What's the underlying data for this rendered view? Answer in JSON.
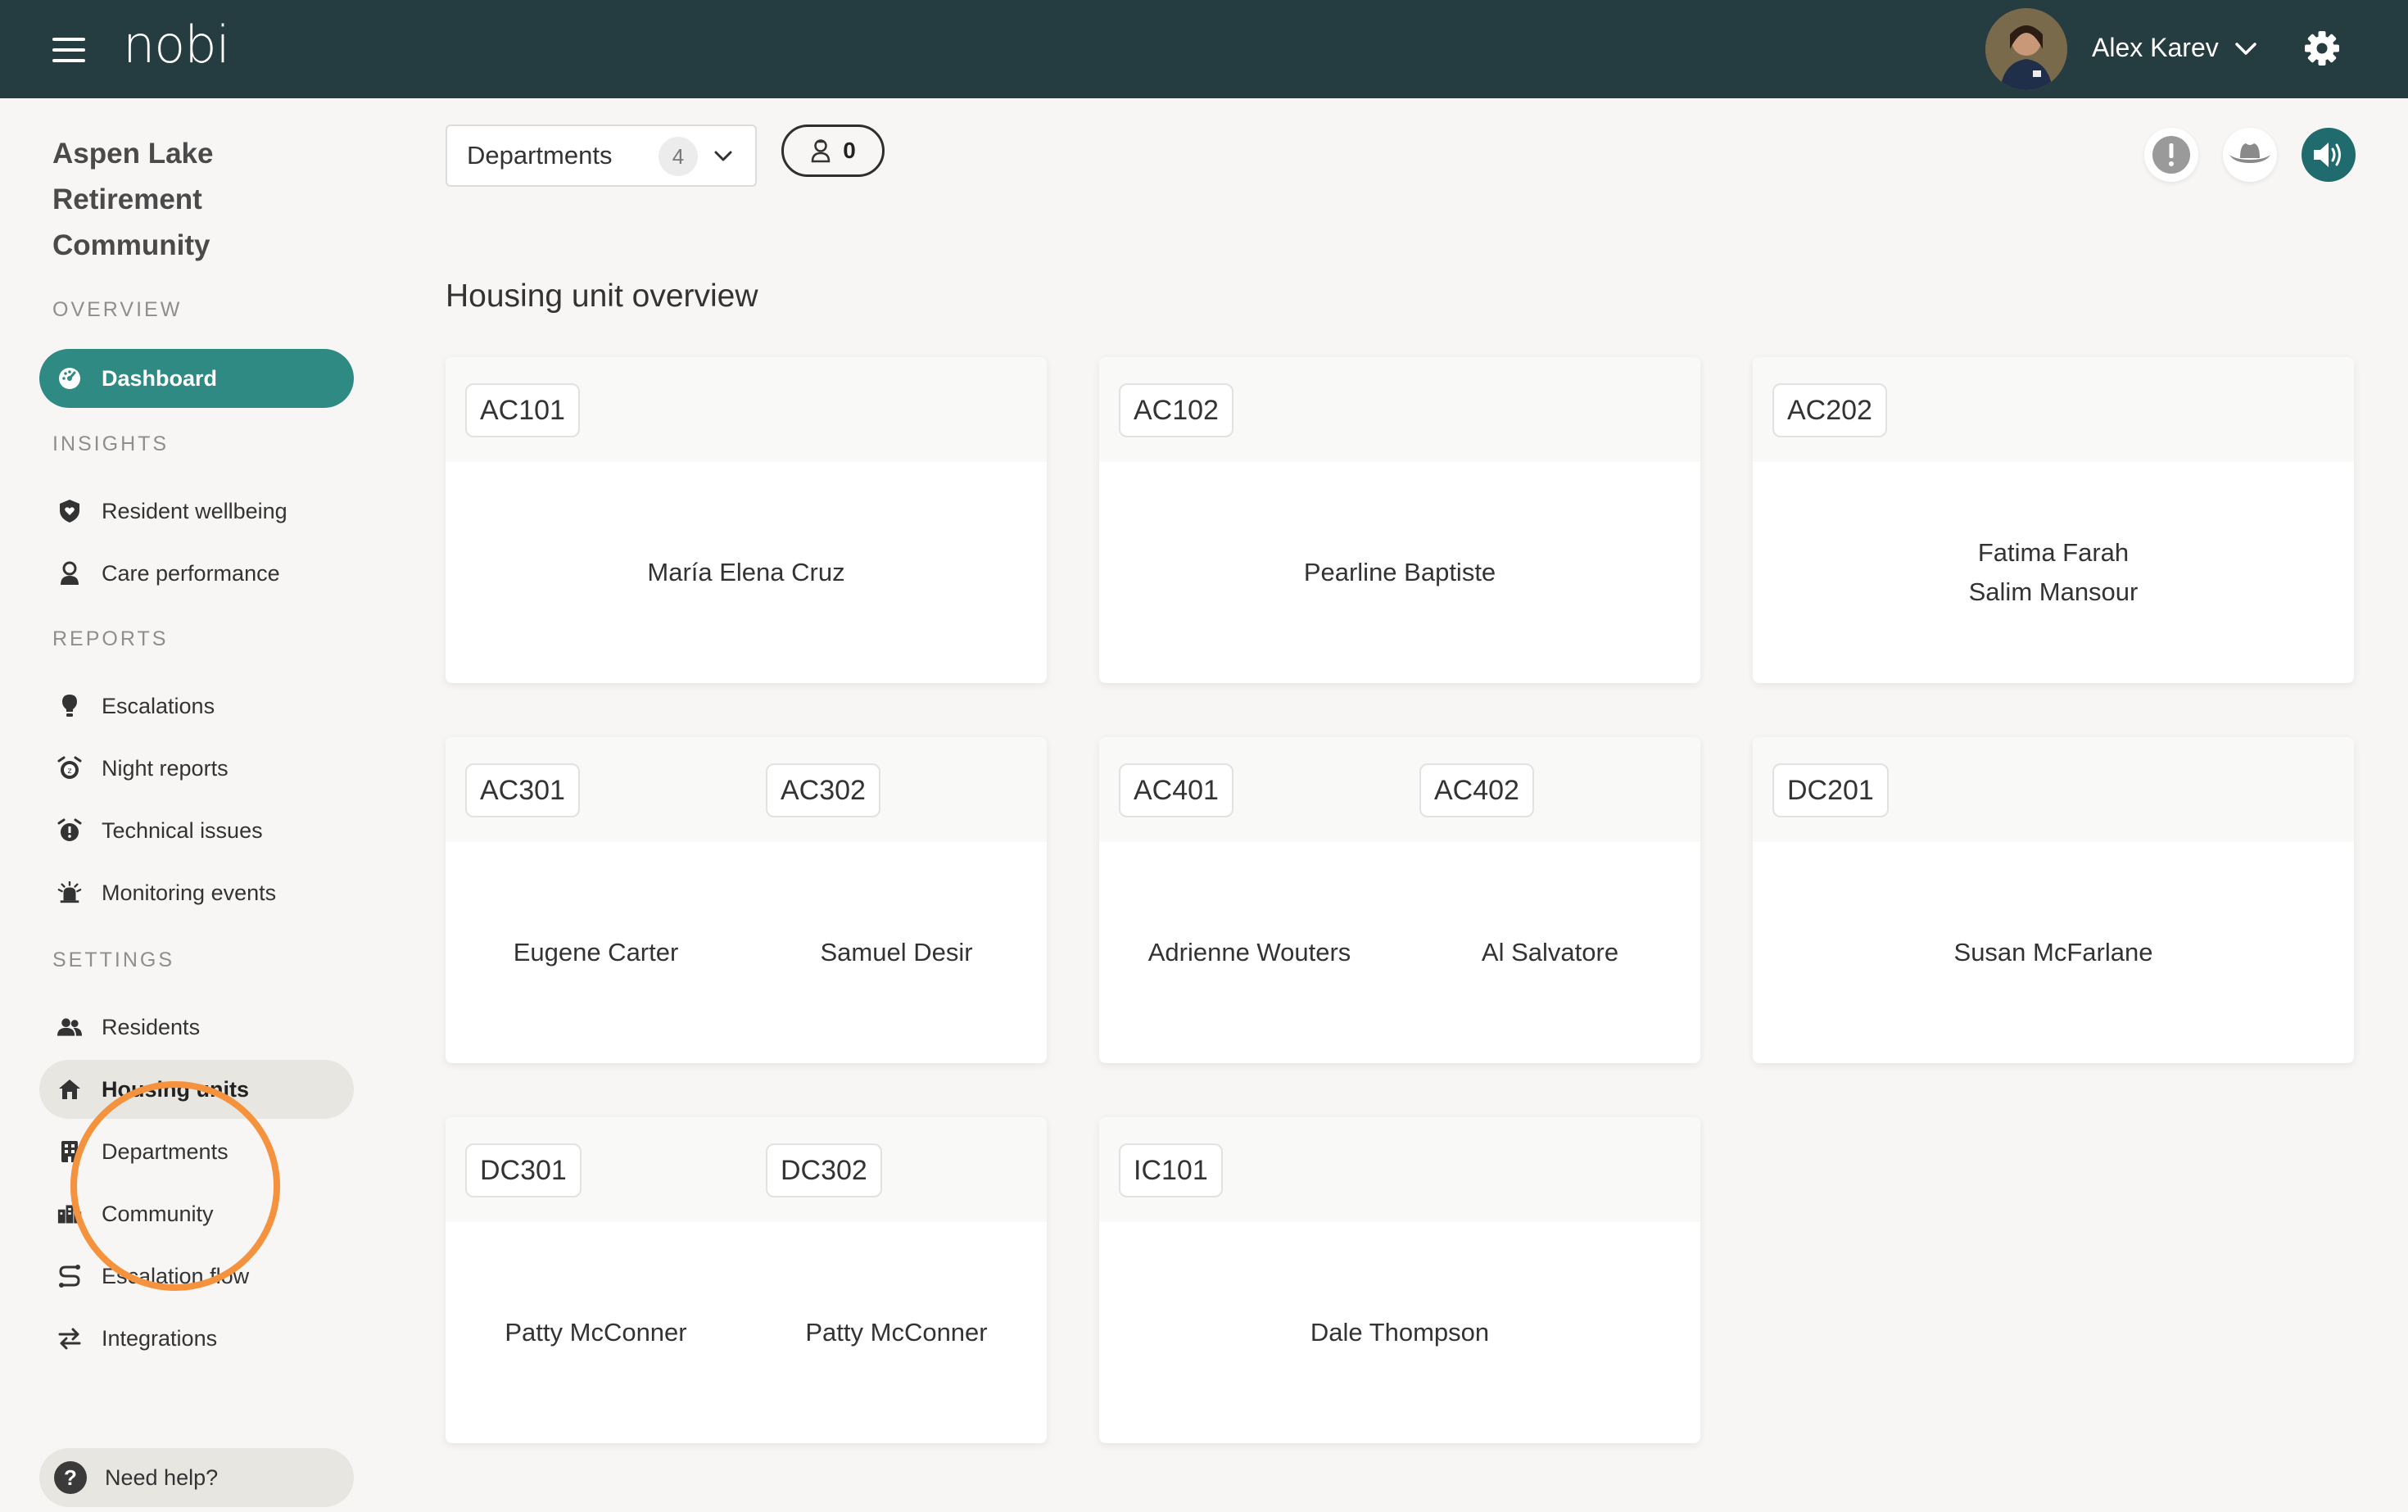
{
  "header": {
    "logo": "nobi",
    "user_name": "Alex Karev"
  },
  "sidebar": {
    "community_name": "Aspen Lake Retirement Community",
    "sections": {
      "overview": "OVERVIEW",
      "insights": "INSIGHTS",
      "reports": "REPORTS",
      "settings": "SETTINGS"
    },
    "items": {
      "dashboard": "Dashboard",
      "resident_wellbeing": "Resident wellbeing",
      "care_performance": "Care performance",
      "escalations": "Escalations",
      "night_reports": "Night reports",
      "technical_issues": "Technical issues",
      "monitoring_events": "Monitoring events",
      "residents": "Residents",
      "housing_units": "Housing units",
      "departments": "Departments",
      "community": "Community",
      "escalation_flow": "Escalation flow",
      "integrations": "Integrations"
    },
    "help": "Need help?",
    "active_item": "dashboard",
    "selected_item": "housing_units"
  },
  "toolbar": {
    "departments_label": "Departments",
    "departments_count": "4",
    "staff_count": "0"
  },
  "main": {
    "title": "Housing unit overview",
    "cards": [
      {
        "units": [
          {
            "code": "AC101",
            "residents": [
              "María Elena Cruz"
            ]
          }
        ]
      },
      {
        "units": [
          {
            "code": "AC102",
            "residents": [
              "Pearline Baptiste"
            ]
          }
        ]
      },
      {
        "units": [
          {
            "code": "AC202",
            "residents": [
              "Fatima Farah",
              "Salim Mansour"
            ]
          }
        ]
      },
      {
        "units": [
          {
            "code": "AC301",
            "residents": [
              "Eugene Carter"
            ]
          },
          {
            "code": "AC302",
            "residents": [
              "Samuel Desir"
            ]
          }
        ]
      },
      {
        "units": [
          {
            "code": "AC401",
            "residents": [
              "Adrienne Wouters"
            ]
          },
          {
            "code": "AC402",
            "residents": [
              "Al Salvatore"
            ]
          }
        ]
      },
      {
        "units": [
          {
            "code": "DC201",
            "residents": [
              "Susan McFarlane"
            ]
          }
        ]
      },
      {
        "units": [
          {
            "code": "DC301",
            "residents": [
              "Patty McConner"
            ]
          },
          {
            "code": "DC302",
            "residents": [
              "Patty McConner"
            ]
          }
        ]
      },
      {
        "units": [
          {
            "code": "IC101",
            "residents": [
              "Dale Thompson"
            ]
          }
        ]
      }
    ]
  },
  "colors": {
    "topbar": "#253c40",
    "accent": "#2e8a83",
    "highlight_ring": "#f5923e",
    "sound_button": "#1f6b6e"
  },
  "icons": {
    "menu": "hamburger-icon",
    "settings": "gear-icon",
    "user_menu": "chevron-down-icon",
    "alert": "exclamation-icon",
    "hat": "hat-icon",
    "sound": "speaker-icon"
  }
}
